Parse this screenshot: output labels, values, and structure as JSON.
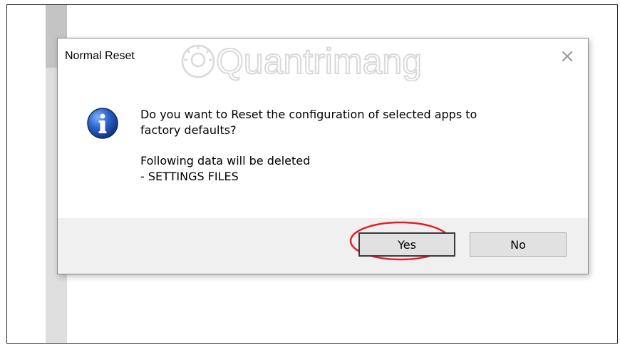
{
  "dialog": {
    "title": "Normal Reset",
    "close_icon": "close-icon",
    "info_icon": "info-icon",
    "message_line1": "Do you want to Reset the configuration of selected apps to",
    "message_line2": "factory defaults?",
    "message_line3": "Following data will be deleted",
    "message_line4": "- SETTINGS FILES",
    "buttons": {
      "yes_label": "Yes",
      "no_label": "No"
    }
  },
  "watermark": {
    "text": "Quantrimang"
  },
  "colors": {
    "highlight_ring": "#e0202a",
    "info_icon_blue": "#1f4fa8",
    "button_bar_bg": "#f0f0f0",
    "button_bg": "#e1e1e1"
  }
}
